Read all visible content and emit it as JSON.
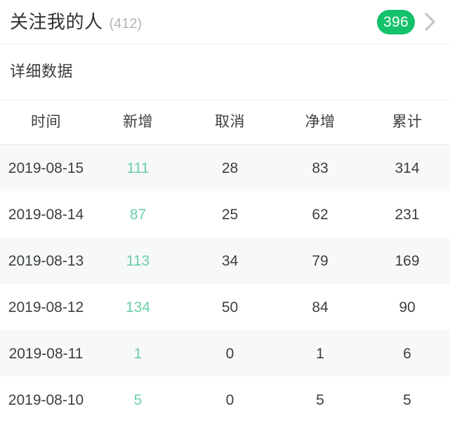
{
  "header": {
    "title": "关注我的人",
    "count": "(412)",
    "badge": "396",
    "chevron_icon": "chevron-right-icon",
    "badge_color": "#14c16c"
  },
  "section": {
    "title": "详细数据"
  },
  "table": {
    "columns": [
      "时间",
      "新增",
      "取消",
      "净增",
      "累计"
    ],
    "rows": [
      {
        "date": "2019-08-15",
        "new": "111",
        "cancel": "28",
        "net": "83",
        "total": "314"
      },
      {
        "date": "2019-08-14",
        "new": "87",
        "cancel": "25",
        "net": "62",
        "total": "231"
      },
      {
        "date": "2019-08-13",
        "new": "113",
        "cancel": "34",
        "net": "79",
        "total": "169"
      },
      {
        "date": "2019-08-12",
        "new": "134",
        "cancel": "50",
        "net": "84",
        "total": "90"
      },
      {
        "date": "2019-08-11",
        "new": "1",
        "cancel": "0",
        "net": "1",
        "total": "6"
      },
      {
        "date": "2019-08-10",
        "new": "5",
        "cancel": "0",
        "net": "5",
        "total": "5"
      }
    ],
    "new_value_color": "#6ccfa6"
  }
}
